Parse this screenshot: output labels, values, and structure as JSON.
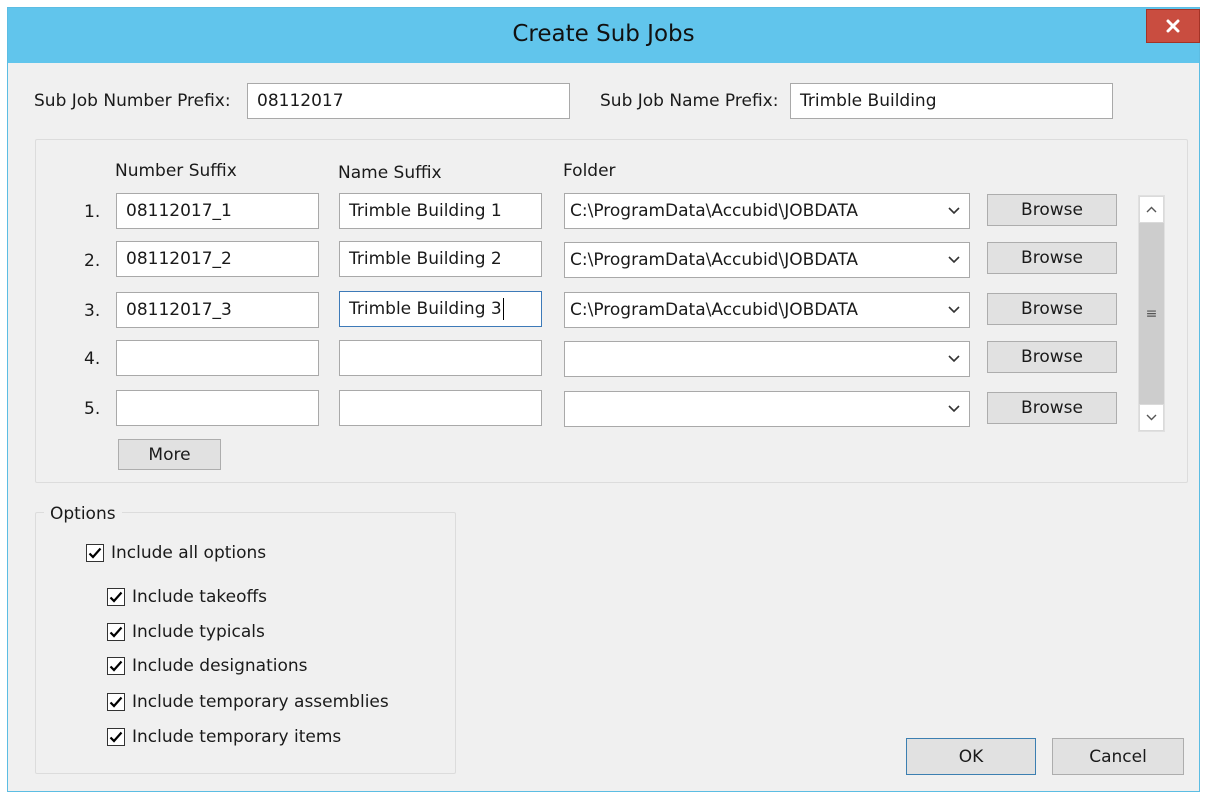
{
  "window": {
    "title": "Create Sub Jobs",
    "close_glyph": "x",
    "colors": {
      "titlebar": "#61c5ec",
      "close": "#c94d40",
      "face": "#f0f0f0"
    }
  },
  "prefix": {
    "number_label": "Sub Job Number Prefix:",
    "number_value": "08112017",
    "name_label": "Sub Job Name Prefix:",
    "name_value": "Trimble Building"
  },
  "grid": {
    "headers": {
      "number_suffix": "Number Suffix",
      "name_suffix": "Name Suffix",
      "folder": "Folder"
    },
    "rows": [
      {
        "index": "1.",
        "number": "08112017_1",
        "name": "Trimble Building 1",
        "folder": "C:\\ProgramData\\Accubid\\JOBDATA",
        "browse": "Browse"
      },
      {
        "index": "2.",
        "number": "08112017_2",
        "name": "Trimble Building 2",
        "folder": "C:\\ProgramData\\Accubid\\JOBDATA",
        "browse": "Browse"
      },
      {
        "index": "3.",
        "number": "08112017_3",
        "name": "Trimble Building 3",
        "folder": "C:\\ProgramData\\Accubid\\JOBDATA",
        "browse": "Browse"
      },
      {
        "index": "4.",
        "number": "",
        "name": "",
        "folder": "",
        "browse": "Browse"
      },
      {
        "index": "5.",
        "number": "",
        "name": "",
        "folder": "",
        "browse": "Browse"
      }
    ],
    "more_label": "More",
    "scrollbar_thumb_glyph": "≡"
  },
  "options": {
    "title": "Options",
    "include_all": {
      "label": "Include all options",
      "checked": true
    },
    "items": [
      {
        "label": "Include takeoffs",
        "checked": true
      },
      {
        "label": "Include typicals",
        "checked": true
      },
      {
        "label": "Include designations",
        "checked": true
      },
      {
        "label": "Include temporary assemblies",
        "checked": true
      },
      {
        "label": "Include temporary items",
        "checked": true
      }
    ]
  },
  "footer": {
    "ok_label": "OK",
    "cancel_label": "Cancel"
  }
}
